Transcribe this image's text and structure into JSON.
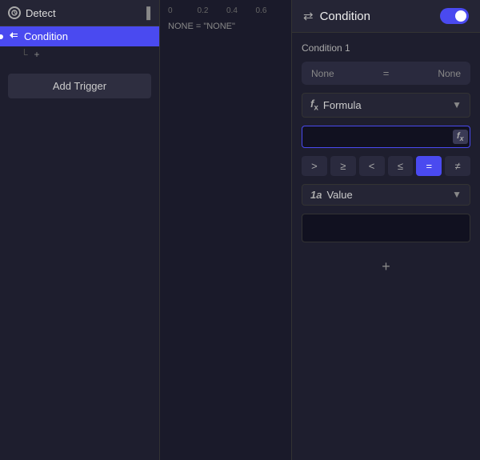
{
  "leftPanel": {
    "header": {
      "title": "Detect",
      "dots": "▐"
    },
    "items": [
      {
        "label": "Condition",
        "active": true,
        "dot": true
      }
    ],
    "subAdd": "+",
    "addTrigger": "Add Trigger"
  },
  "timeline": {
    "rulerMarks": [
      "0",
      "0.2",
      "0.4",
      "0.6"
    ],
    "label": "NONE = \"NONE\""
  },
  "rightPanel": {
    "header": {
      "icon": "⇄",
      "title": "Condition",
      "toggleOn": true
    },
    "conditionSection": {
      "label": "Condition 1",
      "left": "None",
      "operator": "=",
      "right": "None"
    },
    "formulaRow": {
      "icon": "fx",
      "label": "Formula",
      "arrow": "▼"
    },
    "formulaInput": {
      "value": "",
      "placeholder": ""
    },
    "fxBtn": "fx",
    "operators": [
      {
        "symbol": ">",
        "active": false
      },
      {
        "symbol": "≥",
        "active": false
      },
      {
        "symbol": "<",
        "active": false
      },
      {
        "symbol": "≤",
        "active": false
      },
      {
        "symbol": "=",
        "active": true
      },
      {
        "symbol": "≠",
        "active": false
      }
    ],
    "valueRow": {
      "icon": "1a",
      "label": "Value",
      "arrow": "▼"
    },
    "addBtn": "+"
  }
}
